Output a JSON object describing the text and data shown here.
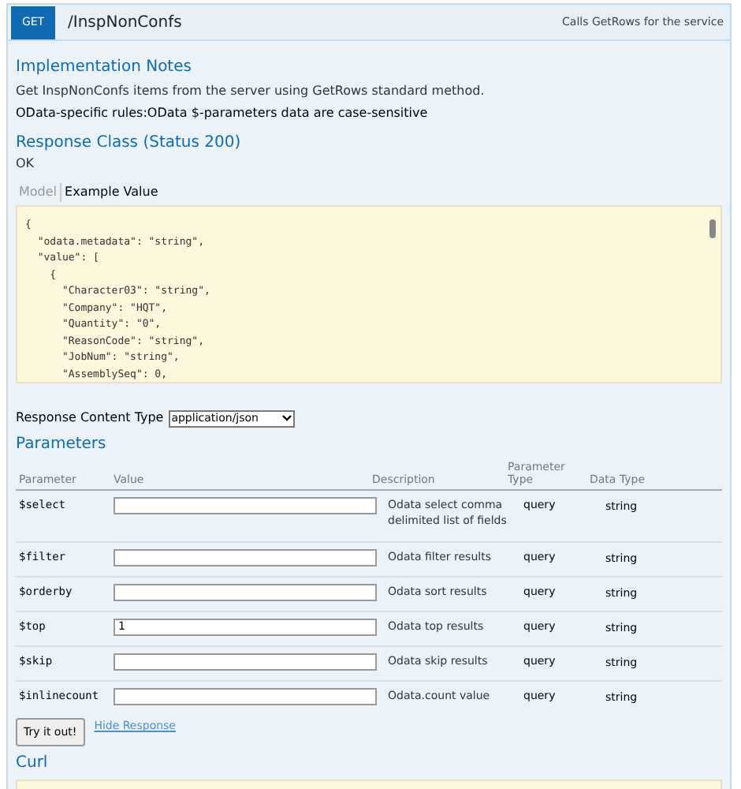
{
  "header": {
    "method": "GET",
    "path": "/InspNonConfs",
    "summary": "Calls GetRows for the service"
  },
  "implementation_notes": {
    "title": "Implementation Notes",
    "text": "Get InspNonConfs items from the server using GetRows standard method.",
    "rules": "OData-specific rules:OData $-parameters data are case-sensitive"
  },
  "response_class": {
    "title": "Response Class (Status 200)",
    "text": "OK"
  },
  "tabs": [
    {
      "label": "Model",
      "selected": false
    },
    {
      "label": "Example Value",
      "selected": true
    }
  ],
  "example_lines": [
    "{",
    "  \"odata.metadata\": \"string\",",
    "  \"value\": [",
    "    {",
    "      \"Character03\": \"string\",",
    "      \"Company\": \"HQT\",",
    "      \"Quantity\": \"0\",",
    "      \"ReasonCode\": \"string\",",
    "      \"JobNum\": \"string\",",
    "      \"AssemblySeq\": 0,"
  ],
  "content_type": {
    "label": "Response Content Type",
    "value": "application/json"
  },
  "parameters": {
    "title": "Parameters",
    "columns": [
      "Parameter",
      "Value",
      "Description",
      "Parameter Type",
      "Data Type"
    ],
    "rows": [
      {
        "name": "$select",
        "value": "",
        "description": "Odata select comma delimited list of fields",
        "type": "query",
        "data_type": "string"
      },
      {
        "name": "$filter",
        "value": "",
        "description": "Odata filter results",
        "type": "query",
        "data_type": "string"
      },
      {
        "name": "$orderby",
        "value": "",
        "description": "Odata sort results",
        "type": "query",
        "data_type": "string"
      },
      {
        "name": "$top",
        "value": "1",
        "description": "Odata top results",
        "type": "query",
        "data_type": "string"
      },
      {
        "name": "$skip",
        "value": "",
        "description": "Odata skip results",
        "type": "query",
        "data_type": "string"
      },
      {
        "name": "$inlinecount",
        "value": "",
        "description": "Odata.count value",
        "type": "query",
        "data_type": "string"
      }
    ]
  },
  "actions": {
    "button": "Try it out!",
    "link": "Hide Response"
  },
  "curl": {
    "title": "Curl"
  }
}
